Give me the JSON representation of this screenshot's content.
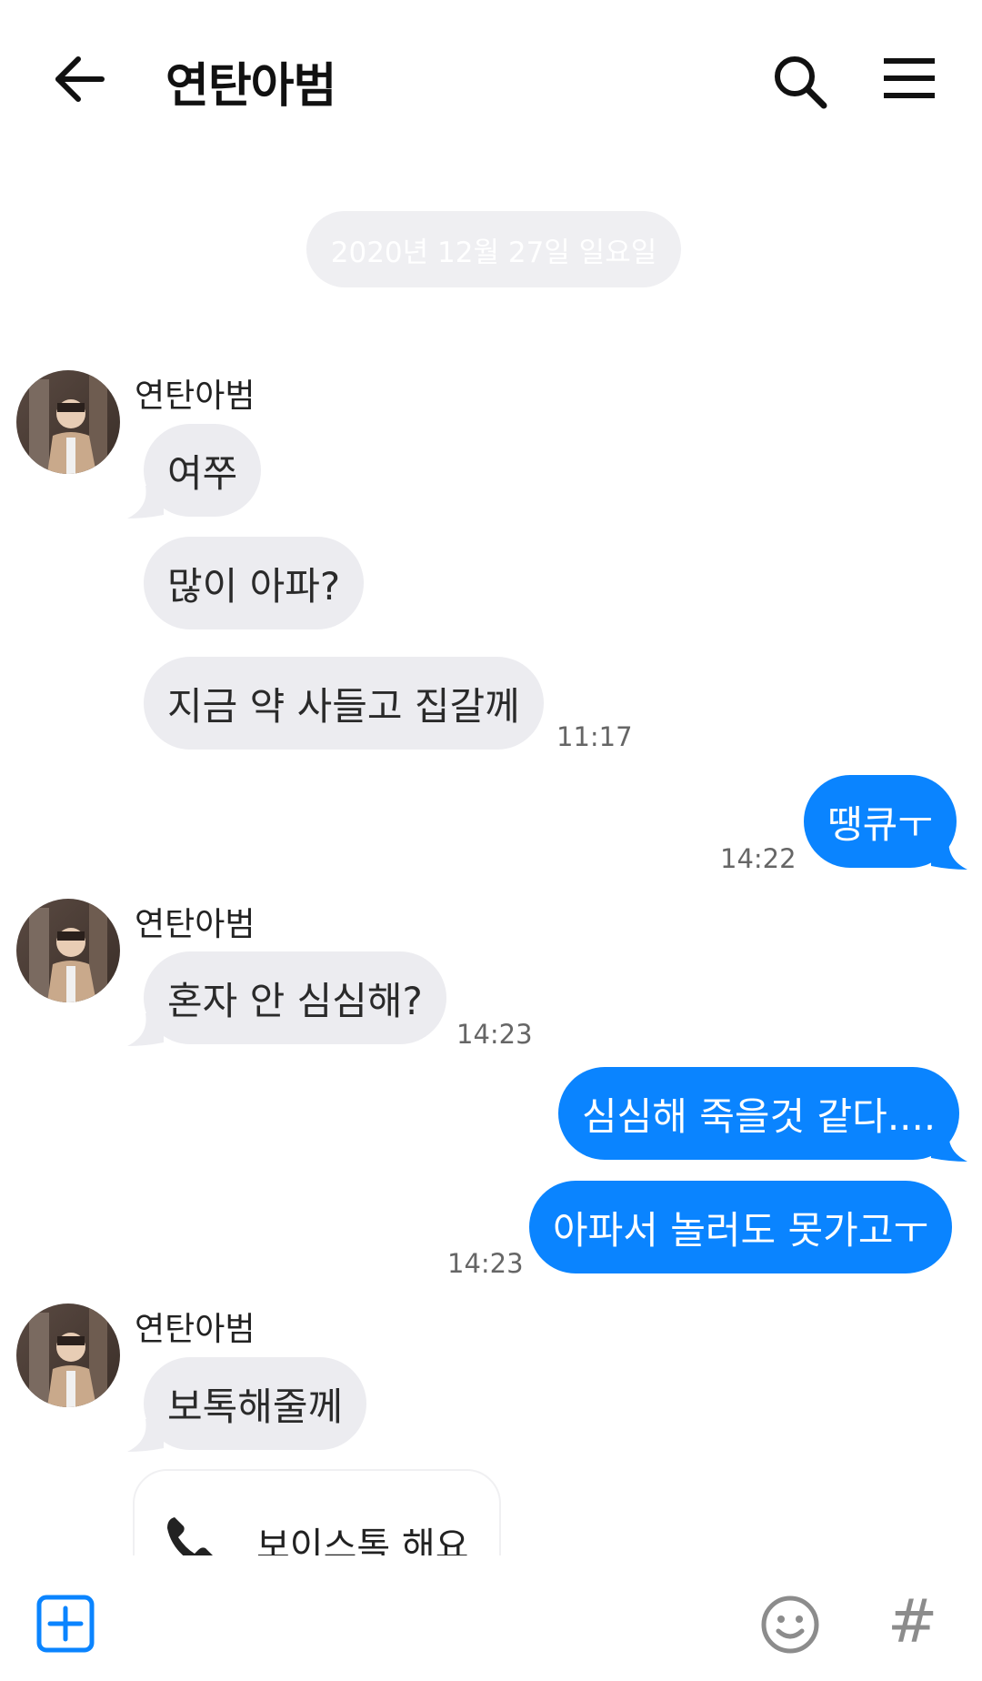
{
  "header": {
    "title": "연탄아범",
    "back_icon": "arrow-left-icon",
    "search_icon": "search-icon",
    "menu_icon": "hamburger-menu-icon"
  },
  "date_divider": "2020년 12월 27일 일요일",
  "colors": {
    "incoming_bubble": "#ececf0",
    "outgoing_bubble": "#0a84ff",
    "accent": "#0a84ff"
  },
  "messages": {
    "group1": {
      "sender": "연탄아범",
      "m1": "여쭈",
      "m2": "많이 아파?",
      "m3": "지금 약 사들고 집갈께",
      "time": "11:17"
    },
    "out1": {
      "m1": "땡큐ㅜ",
      "time": "14:22"
    },
    "group2": {
      "sender": "연탄아범",
      "m1": "혼자 안 심심해?",
      "time": "14:23"
    },
    "out2": {
      "m1": "심심해 죽을것 같다....",
      "m2": "아파서 놀러도 못가고ㅜ",
      "time": "14:23"
    },
    "group3": {
      "sender": "연탄아범",
      "m1": "보톡해줄께",
      "voice_call": "보이스톡 해요",
      "voice_icon": "phone-icon"
    }
  },
  "input_bar": {
    "plus_icon": "plus-square-icon",
    "emoji_icon": "emoji-icon",
    "hash_label": "#"
  }
}
